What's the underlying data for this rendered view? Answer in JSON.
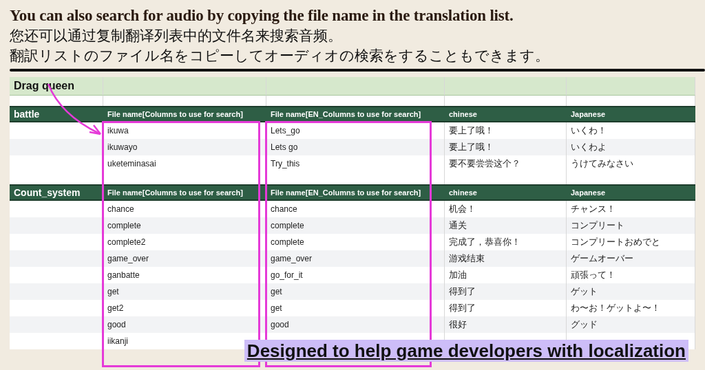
{
  "heading": {
    "title": "You can also search for audio by copying the file name in the translation list.",
    "lines": [
      "您还可以通过复制翻译列表中的文件名来搜索音频。",
      "翻訳リストのファイル名をコピーしてオーディオの検索をすることもできます。"
    ]
  },
  "sheet": {
    "title": "Drag queen",
    "sections": [
      {
        "name": "battle",
        "columns": [
          "File name[Columns to use for search]",
          "File name[EN_Columns to use for search]",
          "chinese",
          "Japanese"
        ],
        "rows": [
          [
            "ikuwa",
            "Lets_go",
            "要上了哦！",
            "いくわ！"
          ],
          [
            "ikuwayo",
            "Lets go",
            "要上了哦！",
            "いくわよ"
          ],
          [
            "uketeminasai",
            "Try_this",
            "要不要尝尝这个？",
            "うけてみなさい"
          ]
        ]
      },
      {
        "name": "Count_system",
        "columns": [
          "File name[Columns to use for search]",
          "File name[EN_Columns to use for search]",
          "chinese",
          "Japanese"
        ],
        "rows": [
          [
            "chance",
            "chance",
            "机会！",
            "チャンス！"
          ],
          [
            "complete",
            "complete",
            "通关",
            "コンプリート"
          ],
          [
            "complete2",
            "complete",
            "完成了，恭喜你！",
            "コンプリートおめでと"
          ],
          [
            "game_over",
            "game_over",
            "游戏结束",
            "ゲームオーバー"
          ],
          [
            "ganbatte",
            "go_for_it",
            "加油",
            "頑張って！"
          ],
          [
            "get",
            "get",
            "得到了",
            "ゲット"
          ],
          [
            "get2",
            "get",
            "得到了",
            "わ〜お！ゲットよ〜！"
          ],
          [
            "good",
            "good",
            "很好",
            "グッド"
          ],
          [
            "iikanji"
          ]
        ]
      }
    ]
  },
  "banner": "Designed to help game developers with localization"
}
